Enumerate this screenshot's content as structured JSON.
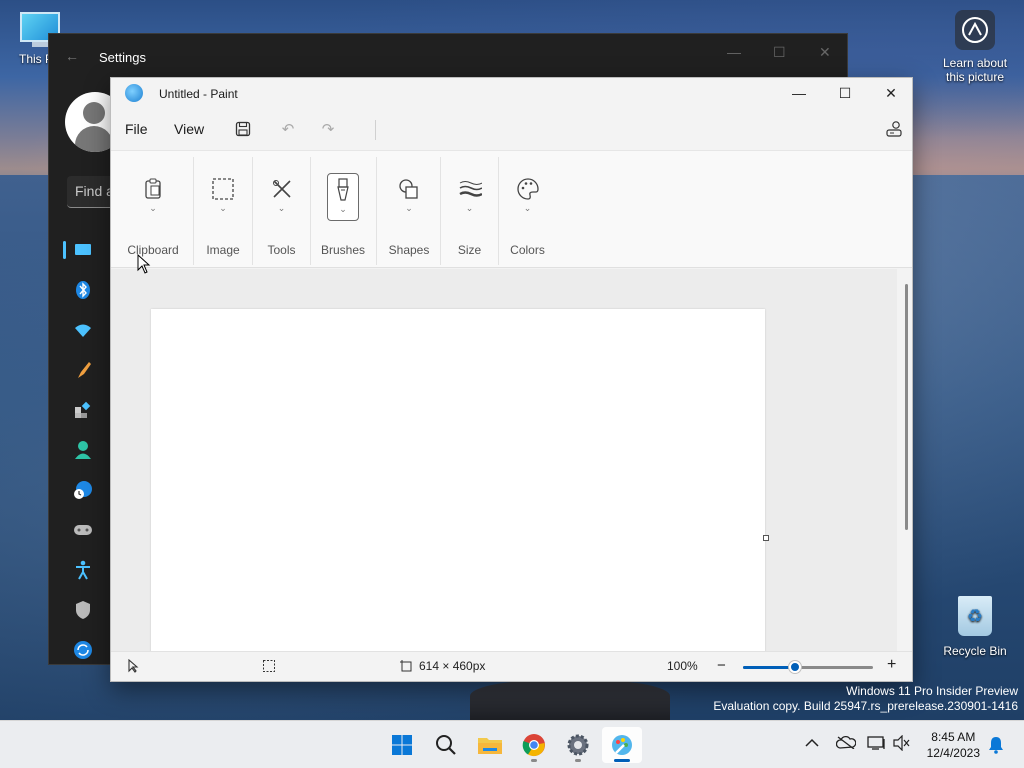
{
  "desktop": {
    "this_pc_label": "This P",
    "learn_label_1": "Learn about",
    "learn_label_2": "this picture",
    "recycle_bin_label": "Recycle Bin",
    "watermark_line1": "Windows 11 Pro Insider Preview",
    "watermark_line2": "Evaluation copy. Build 25947.rs_prerelease.230901-1416"
  },
  "settings": {
    "title": "Settings",
    "search_placeholder": "Find a",
    "nav_icons": [
      "system-icon",
      "bluetooth-icon",
      "network-icon",
      "personalization-icon",
      "apps-icon",
      "accounts-icon",
      "time-language-icon",
      "gaming-icon",
      "accessibility-icon",
      "privacy-icon",
      "windows-update-icon"
    ],
    "accent_color": "#4cc2ff"
  },
  "paint": {
    "title": "Untitled - Paint",
    "menu": {
      "file": "File",
      "view": "View"
    },
    "groups": [
      {
        "label": "Clipboard",
        "icon": "clipboard-icon"
      },
      {
        "label": "Image",
        "icon": "selection-icon"
      },
      {
        "label": "Tools",
        "icon": "tools-icon"
      },
      {
        "label": "Brushes",
        "icon": "brush-icon",
        "selected": true
      },
      {
        "label": "Shapes",
        "icon": "shapes-icon"
      },
      {
        "label": "Size",
        "icon": "size-icon"
      },
      {
        "label": "Colors",
        "icon": "palette-icon"
      }
    ],
    "status": {
      "canvas_size": "614 × 460px",
      "zoom": "100%",
      "zoom_fraction": 0.4
    },
    "accent_color": "#005fb8"
  },
  "taskbar": {
    "apps": [
      "start-icon",
      "search-icon",
      "file-explorer-icon",
      "chrome-icon",
      "settings-icon",
      "paint-icon"
    ],
    "time": "8:45 AM",
    "date": "12/4/2023"
  }
}
